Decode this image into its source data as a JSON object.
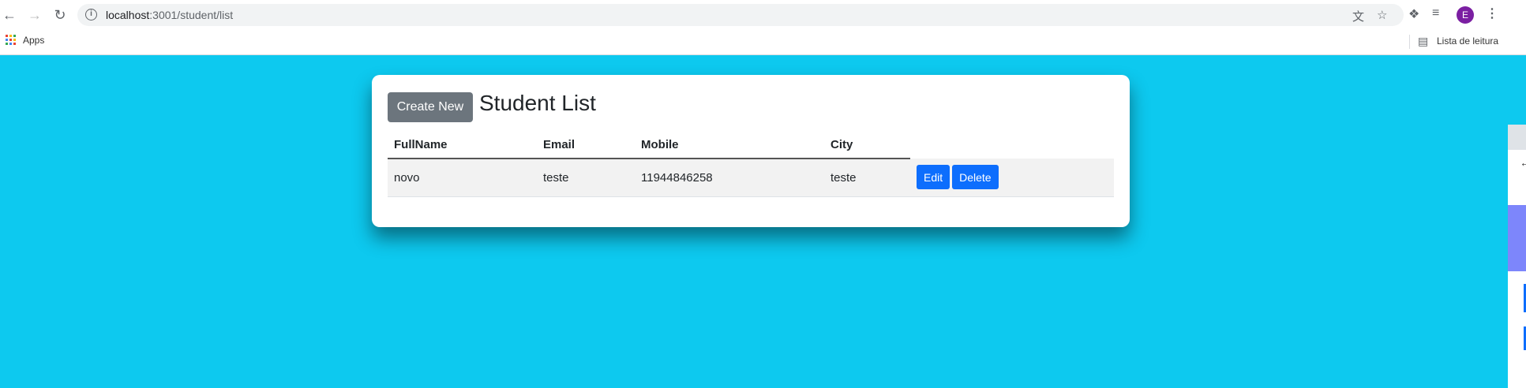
{
  "browser": {
    "url_host": "localhost",
    "url_rest": ":3001/student/list",
    "avatar_letter": "E",
    "avatar_color": "#7b1fa2"
  },
  "bookmarks": {
    "apps_label": "Apps",
    "reading_list_label": "Lista de leitura"
  },
  "page": {
    "background": "#0dc9ef",
    "create_new_label": "Create New",
    "title": "Student List",
    "columns": [
      "FullName",
      "Email",
      "Mobile",
      "City"
    ],
    "rows": [
      {
        "fullname": "novo",
        "email": "teste",
        "mobile": "11944846258",
        "city": "teste"
      }
    ],
    "edit_label": "Edit",
    "delete_label": "Delete"
  }
}
